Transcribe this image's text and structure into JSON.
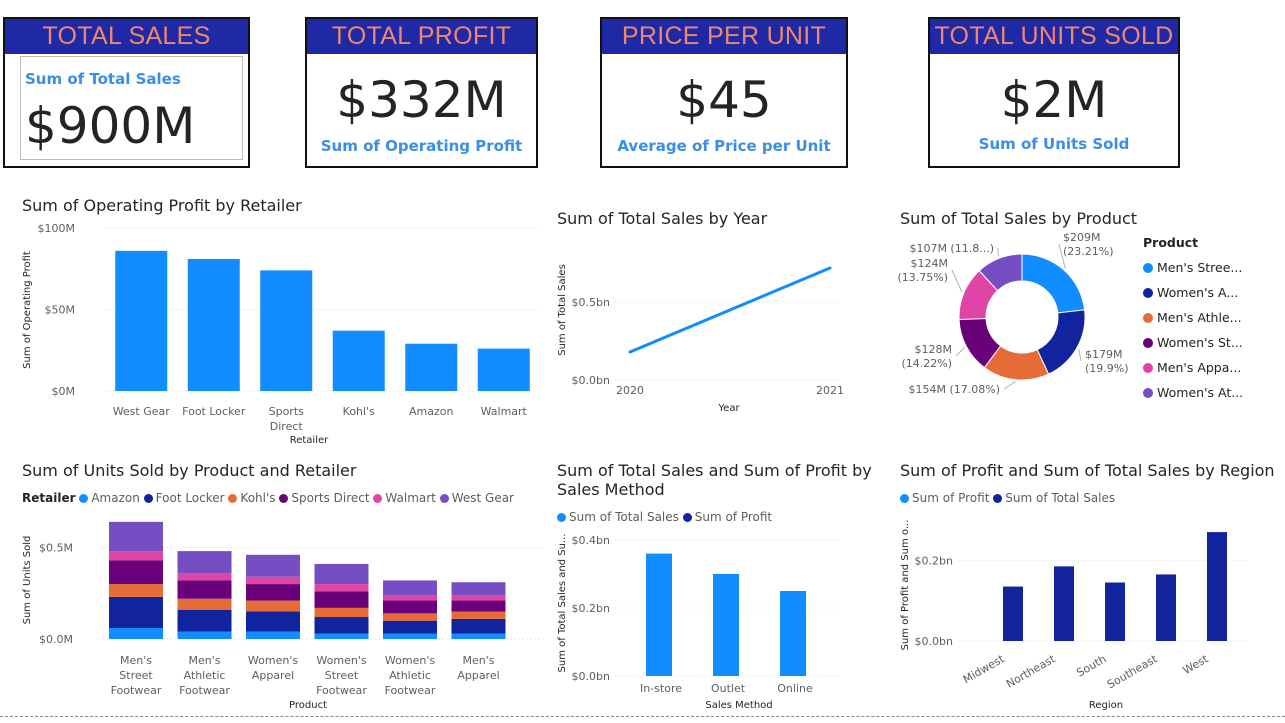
{
  "cards": [
    {
      "title": "TOTAL SALES",
      "value": "$900M",
      "label": "Sum of Total Sales"
    },
    {
      "title": "TOTAL PROFIT",
      "value": "$332M",
      "label": "Sum of Operating Profit"
    },
    {
      "title": "PRICE PER UNIT",
      "value": "$45",
      "label": "Average of Price per Unit"
    },
    {
      "title": "TOTAL UNITS SOLD",
      "value": "$2M",
      "label": "Sum of Units Sold"
    }
  ],
  "colors": {
    "bright_blue": "#118dff",
    "dark_blue": "#12239e",
    "orange": "#e66c37",
    "purple": "#6b007b",
    "pink": "#e044a7",
    "violet": "#744ec2",
    "card_header": "#1f28a5"
  },
  "charts": {
    "profit_by_retailer": {
      "title": "Sum of Operating Profit by Retailer",
      "ylabel": "Sum of Operating Profit",
      "xlabel": "Retailer",
      "ticks": [
        "$100M",
        "$50M",
        "$0M"
      ],
      "categories": [
        [
          "West Gear"
        ],
        [
          "Foot Locker"
        ],
        [
          "Sports",
          "Direct"
        ],
        [
          "Kohl's"
        ],
        [
          "Amazon"
        ],
        [
          "Walmart"
        ]
      ]
    },
    "sales_by_year": {
      "title": "Sum of Total Sales by Year",
      "ylabel": "Sum of Total Sales",
      "xlabel": "Year",
      "ticks": [
        "$0.5bn",
        "$0.0bn"
      ],
      "xticks": [
        "2020",
        "2021"
      ]
    },
    "sales_by_product": {
      "title": "Sum of Total Sales by Product",
      "legend_title": "Product",
      "legend": [
        "Men's Stree...",
        "Women's A...",
        "Men's Athle...",
        "Women's St...",
        "Men's Appa...",
        "Women's At..."
      ],
      "labels": [
        [
          "$209M",
          "(23.21%)"
        ],
        [
          "$179M",
          "(19.9%)"
        ],
        [
          "$154M (17.08%)"
        ],
        [
          "$128M",
          "(14.22%)"
        ],
        [
          "$124M",
          "(13.75%)"
        ],
        [
          "$107M (11.8...)"
        ]
      ]
    },
    "units_by_product_retailer": {
      "title": "Sum of Units Sold by Product and Retailer",
      "legend_title": "Retailer",
      "legend": [
        "Amazon",
        "Foot Locker",
        "Kohl's",
        "Sports Direct",
        "Walmart",
        "West Gear"
      ],
      "ylabel": "Sum of Units Sold",
      "xlabel": "Product",
      "ticks": [
        "$0.5M",
        "$0.0M"
      ],
      "categories": [
        [
          "Men's",
          "Street",
          "Footwear"
        ],
        [
          "Men's",
          "Athletic",
          "Footwear"
        ],
        [
          "Women's",
          "Apparel"
        ],
        [
          "Women's",
          "Street",
          "Footwear"
        ],
        [
          "Women's",
          "Athletic",
          "Footwear"
        ],
        [
          "Men's",
          "Apparel"
        ]
      ]
    },
    "sales_profit_by_method": {
      "title_lines": [
        "Sum of Total Sales and Sum of Profit by",
        "Sales Method"
      ],
      "legend": [
        "Sum of Total Sales",
        "Sum of Profit"
      ],
      "ylabel": "Sum of Total Sales and Su...",
      "xlabel": "Sales Method",
      "ticks": [
        "$0.4bn",
        "$0.2bn",
        "$0.0bn"
      ],
      "categories": [
        "In-store",
        "Outlet",
        "Online"
      ]
    },
    "profit_sales_by_region": {
      "title": "Sum of Profit and Sum of Total Sales by Region",
      "legend": [
        "Sum of Profit",
        "Sum of Total Sales"
      ],
      "ylabel": "Sum of Profit and Sum o...",
      "xlabel": "Region",
      "ticks": [
        "$0.2bn",
        "$0.0bn"
      ],
      "categories": [
        "Midwest",
        "Northeast",
        "South",
        "Southeast",
        "West"
      ]
    }
  },
  "chart_data": [
    {
      "type": "bar",
      "title": "Sum of Operating Profit by Retailer",
      "categories": [
        "West Gear",
        "Foot Locker",
        "Sports Direct",
        "Kohl's",
        "Amazon",
        "Walmart"
      ],
      "values": [
        86,
        81,
        74,
        37,
        29,
        26
      ],
      "ylim": [
        0,
        100
      ],
      "unit": "$M",
      "xlabel": "Retailer",
      "ylabel": "Sum of Operating Profit"
    },
    {
      "type": "line",
      "title": "Sum of Total Sales by Year",
      "x": [
        2020,
        2021
      ],
      "values": [
        0.18,
        0.72
      ],
      "ylim": [
        0,
        0.9
      ],
      "unit": "$bn",
      "xlabel": "Year",
      "ylabel": "Sum of Total Sales"
    },
    {
      "type": "pie",
      "title": "Sum of Total Sales by Product",
      "categories": [
        "Men's Street Footwear",
        "Women's Apparel",
        "Men's Athletic Footwear",
        "Women's Street Footwear",
        "Men's Apparel",
        "Women's Athletic Footwear"
      ],
      "values": [
        209,
        179,
        154,
        128,
        124,
        107
      ],
      "percents": [
        23.21,
        19.9,
        17.08,
        14.22,
        13.75,
        11.8
      ],
      "unit": "$M"
    },
    {
      "type": "bar",
      "stacked": true,
      "title": "Sum of Units Sold by Product and Retailer",
      "categories": [
        "Men's Street Footwear",
        "Men's Athletic Footwear",
        "Women's Apparel",
        "Women's Street Footwear",
        "Women's Athletic Footwear",
        "Men's Apparel"
      ],
      "series": [
        {
          "name": "Amazon",
          "values": [
            0.06,
            0.04,
            0.04,
            0.03,
            0.03,
            0.03
          ]
        },
        {
          "name": "Foot Locker",
          "values": [
            0.17,
            0.12,
            0.11,
            0.09,
            0.07,
            0.08
          ]
        },
        {
          "name": "Kohl's",
          "values": [
            0.07,
            0.06,
            0.06,
            0.05,
            0.04,
            0.04
          ]
        },
        {
          "name": "Sports Direct",
          "values": [
            0.13,
            0.1,
            0.09,
            0.09,
            0.07,
            0.06
          ]
        },
        {
          "name": "Walmart",
          "values": [
            0.05,
            0.04,
            0.04,
            0.04,
            0.03,
            0.03
          ]
        },
        {
          "name": "West Gear",
          "values": [
            0.16,
            0.12,
            0.12,
            0.11,
            0.08,
            0.07
          ]
        }
      ],
      "ylim": [
        0,
        0.65
      ],
      "unit": "M",
      "xlabel": "Product",
      "ylabel": "Sum of Units Sold"
    },
    {
      "type": "bar",
      "title": "Sum of Total Sales and Sum of Profit by Sales Method",
      "categories": [
        "In-store",
        "Outlet",
        "Online"
      ],
      "series": [
        {
          "name": "Sum of Total Sales",
          "values": [
            0.36,
            0.3,
            0.25
          ]
        },
        {
          "name": "Sum of Profit",
          "values": [
            0,
            0,
            0
          ]
        }
      ],
      "ylim": [
        0,
        0.4
      ],
      "unit": "$bn",
      "xlabel": "Sales Method",
      "ylabel": "Sum of Total Sales and Su..."
    },
    {
      "type": "bar",
      "title": "Sum of Profit and Sum of Total Sales by Region",
      "categories": [
        "Midwest",
        "Northeast",
        "South",
        "Southeast",
        "West"
      ],
      "series": [
        {
          "name": "Sum of Profit",
          "values": [
            0,
            0,
            0,
            0,
            0
          ]
        },
        {
          "name": "Sum of Total Sales",
          "values": [
            0.135,
            0.185,
            0.145,
            0.165,
            0.27
          ]
        }
      ],
      "ylim": [
        0,
        0.3
      ],
      "unit": "$bn",
      "xlabel": "Region",
      "ylabel": "Sum of Profit and Sum o..."
    }
  ]
}
